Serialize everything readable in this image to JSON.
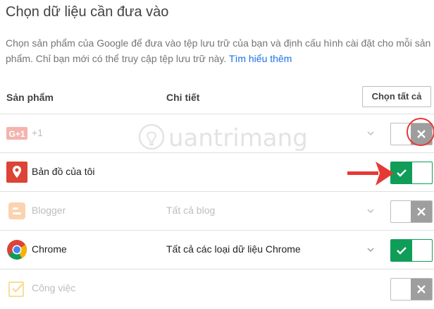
{
  "page": {
    "title": "Chọn dữ liệu cần đưa vào",
    "description": "Chọn sản phẩm của Google để đưa vào tệp lưu trữ của bạn và định cấu hình cài đặt cho mỗi sản phẩm. Chỉ bạn mới có thể truy cập tệp lưu trữ này. ",
    "learn_more": "Tìm hiểu thêm"
  },
  "table": {
    "col_product": "Sản phẩm",
    "col_detail": "Chi tiết",
    "select_all": "Chọn tất cả"
  },
  "rows": [
    {
      "name": "+1",
      "detail": "",
      "enabled": false,
      "has_chevron": true,
      "icon": "google-plus-one-icon"
    },
    {
      "name": "Bản đồ của tôi",
      "detail": "",
      "enabled": true,
      "has_chevron": false,
      "icon": "maps-pin-icon"
    },
    {
      "name": "Blogger",
      "detail": "Tất cả blog",
      "enabled": false,
      "has_chevron": true,
      "icon": "blogger-icon"
    },
    {
      "name": "Chrome",
      "detail": "Tất cả các loại dữ liệu Chrome",
      "enabled": true,
      "has_chevron": true,
      "icon": "chrome-icon"
    },
    {
      "name": "Công việc",
      "detail": "",
      "enabled": false,
      "has_chevron": false,
      "icon": "tasks-icon"
    }
  ],
  "watermark": {
    "text": "uantrimang"
  },
  "colors": {
    "toggle_on": "#0f9d58",
    "toggle_off": "#9e9e9e",
    "link": "#1a73e8",
    "annotation": "#e53935"
  }
}
